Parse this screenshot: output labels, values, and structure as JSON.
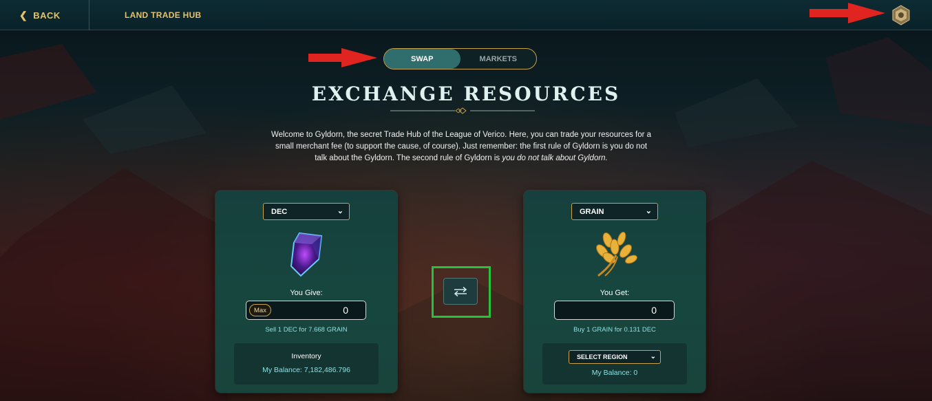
{
  "header": {
    "back_label": "BACK",
    "title": "LAND TRADE HUB"
  },
  "tabs": {
    "swap_label": "SWAP",
    "markets_label": "MARKETS",
    "active": "SWAP"
  },
  "main": {
    "heading": "EXCHANGE RESOURCES",
    "intro_text": "Welcome to Gyldorn, the secret Trade Hub of the League of Verico. Here, you can trade your resources for a small merchant fee (to support the cause, of course). Just remember: the first rule of Gyldorn is you do not talk about the Gyldorn. The second rule of Gyldorn is ",
    "intro_italic": "you do not talk about Gyldorn."
  },
  "give_card": {
    "resource": "DEC",
    "field_label": "You Give:",
    "max_label": "Max",
    "amount": "0",
    "rate": "Sell 1 DEC for 7.668 GRAIN",
    "inventory_label": "Inventory",
    "balance": "My Balance: 7,182,486.796"
  },
  "get_card": {
    "resource": "GRAIN",
    "field_label": "You Get:",
    "amount": "0",
    "rate": "Buy 1 GRAIN for 0.131 DEC",
    "region_select": "SELECT REGION",
    "balance": "My Balance: 0"
  },
  "icons": {
    "back": "chevron-left-icon",
    "avatar": "player-emblem-icon",
    "swap": "swap-arrows-icon",
    "give_resource": "dec-crystal-icon",
    "get_resource": "grain-wheat-icon"
  },
  "colors": {
    "accent_gold": "#e6c36a",
    "active_tab": "#2f6e6c",
    "rate_text": "#8ee0e2",
    "annotation_arrow": "#e0241f",
    "highlight_box": "#25c23c"
  }
}
